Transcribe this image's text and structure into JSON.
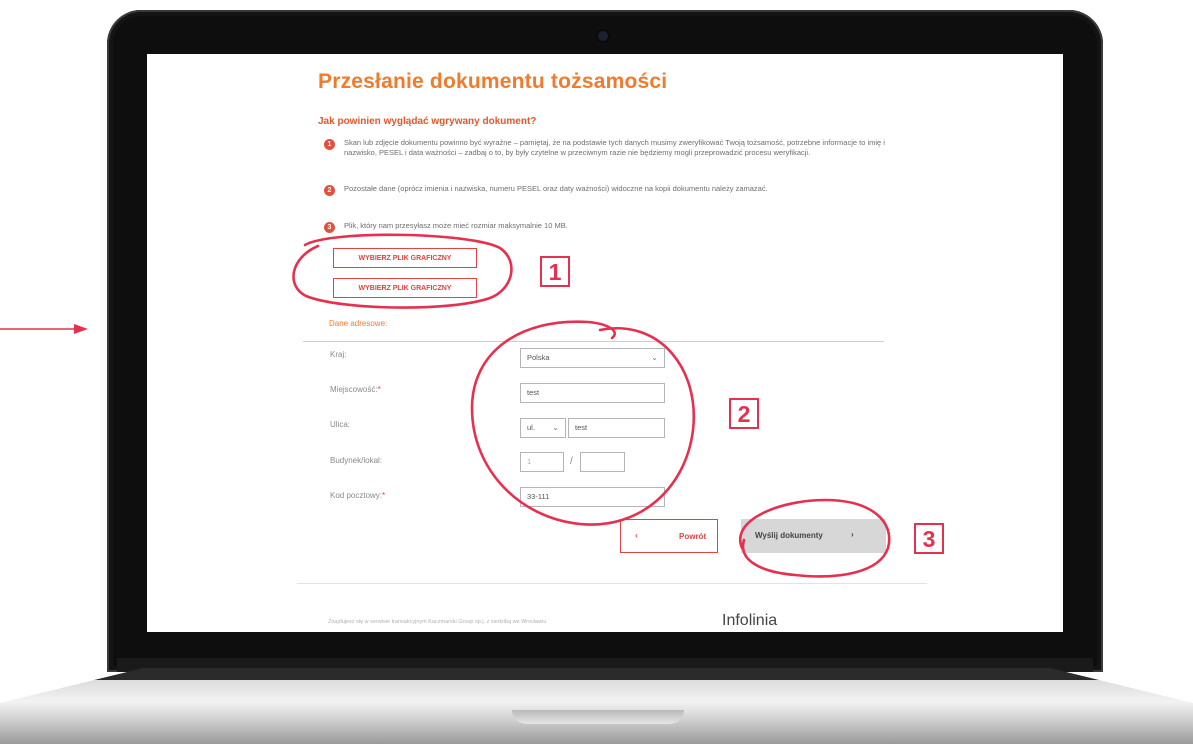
{
  "page": {
    "title": "Przesłanie dokumentu tożsamości",
    "subtitle": "Jak powinien wyglądać wgrywany dokument?"
  },
  "steps": [
    {
      "num": "1",
      "text": "Skan lub zdjęcie dokumentu powinno być wyraźne – pamiętaj, że na podstawie tych danych musimy zweryfikować Twoją tożsamość, potrzebne informacje to imię i nazwisko, PESEL i data ważności – zadbaj o to, by były czytelne w przeciwnym razie nie będziemy mogli przeprowadzić procesu weryfikacji."
    },
    {
      "num": "2",
      "text": "Pozostałe dane (oprócz imienia i nazwiska, numeru PESEL oraz daty ważności) widoczne na kopii dokumentu należy zamazać."
    },
    {
      "num": "3",
      "text": "Plik, który nam przesyłasz może mieć rozmiar maksymalnie 10 MB."
    }
  ],
  "upload": {
    "button1": "WYBIERZ PLIK GRAFICZNY",
    "button2": "WYBIERZ PLIK GRAFICZNY"
  },
  "address": {
    "section_label": "Dane adresowe:",
    "country_label": "Kraj:",
    "country_value": "Polska",
    "city_label": "Miejscowość:",
    "city_value": "test",
    "street_label": "Ulica:",
    "street_prefix": "ul.",
    "street_value": "test",
    "building_label": "Budynek/lokal:",
    "building_placeholder": "1",
    "slash": "/",
    "postal_label": "Kod pocztowy:",
    "postal_value": "33-111",
    "required_mark": "*"
  },
  "actions": {
    "back_label": "Powrót",
    "send_label": "Wyślij dokumenty"
  },
  "footer": {
    "text": "Znajdujesz się w serwisie transakcyjnym Kaczmarski Group sp.j. z siedzibą we Wrocławiu",
    "infolinia": "Infolinia"
  },
  "annotations": {
    "labels": [
      "1",
      "2",
      "3"
    ],
    "color": "#e6304f"
  },
  "colors": {
    "title": "#ef7b2f",
    "accent": "#e2433f",
    "send_button_bg": "#d7d7d7"
  }
}
